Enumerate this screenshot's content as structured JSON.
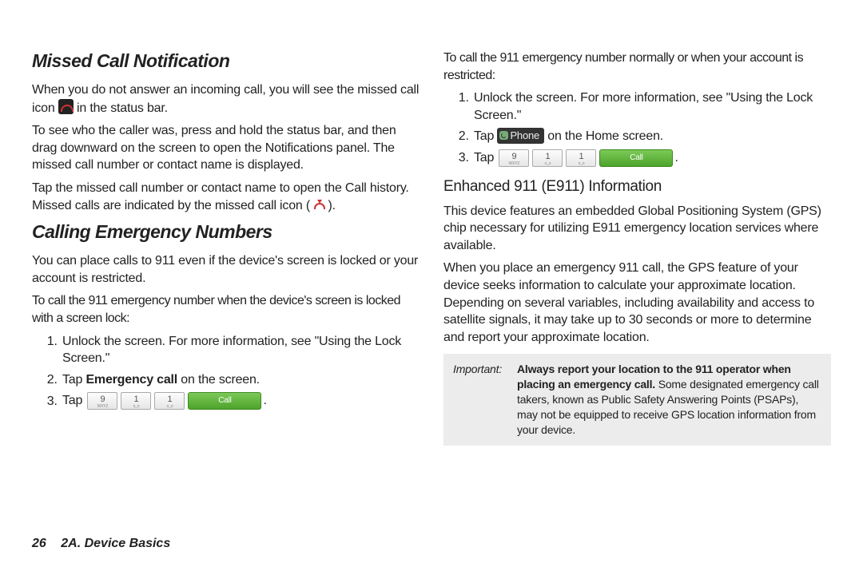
{
  "left": {
    "heading1": "Missed Call Notification",
    "p1a": "When you do not answer an incoming call, you will see the missed call icon ",
    "p1b": " in the status bar.",
    "p2": "To see who the caller was, press and hold the status bar, and then drag downward on the screen to open the Notifications panel. The missed call number or contact name is displayed.",
    "p3a": "Tap the missed call number or contact name to open the Call history. Missed calls are indicated by the missed call icon ( ",
    "p3b": " ).",
    "heading2": "Calling Emergency Numbers",
    "p4": "You can place calls to 911 even if the device's screen is locked or your account is restricted.",
    "lead1": "To call the 911 emergency number when the device's screen is locked with a screen lock:",
    "li1": "Unlock the screen. For more information, see \"Using the Lock Screen.\"",
    "li2a": "Tap ",
    "li2b": "Emergency call",
    "li2c": " on the screen.",
    "li3": "Tap "
  },
  "right": {
    "lead2": "To call the 911 emergency number normally or when your account is restricted:",
    "li1": "Unlock the screen. For more information, see \"Using the Lock Screen.\"",
    "li2a": "Tap ",
    "li2b": " on the Home screen.",
    "li3": "Tap ",
    "subheading": "Enhanced 911 (E911) Information",
    "p1": "This device features an embedded Global Positioning System (GPS) chip necessary for utilizing E911 emergency location services where available.",
    "p2": "When you place an emergency 911 call, the GPS feature of your device seeks information to calculate your approximate location. Depending on several variables, including availability and access to satellite signals, it may take up to 30 seconds or more to determine and report your approximate location.",
    "imp_label": "Important:",
    "imp_bold": "Always report your location to the 911 operator when placing an emergency call.",
    "imp_rest": " Some designated emergency call takers, known as Public Safety Answering Points (PSAPs), may not be equipped to receive GPS location information from your device."
  },
  "dial": {
    "k9": "9",
    "k9s": "WXYZ",
    "k1": "1",
    "k1s": "o_o",
    "call": "Call"
  },
  "phonebtn": "Phone",
  "footer": {
    "pagenum": "26",
    "chapter": "2A. Device Basics"
  }
}
